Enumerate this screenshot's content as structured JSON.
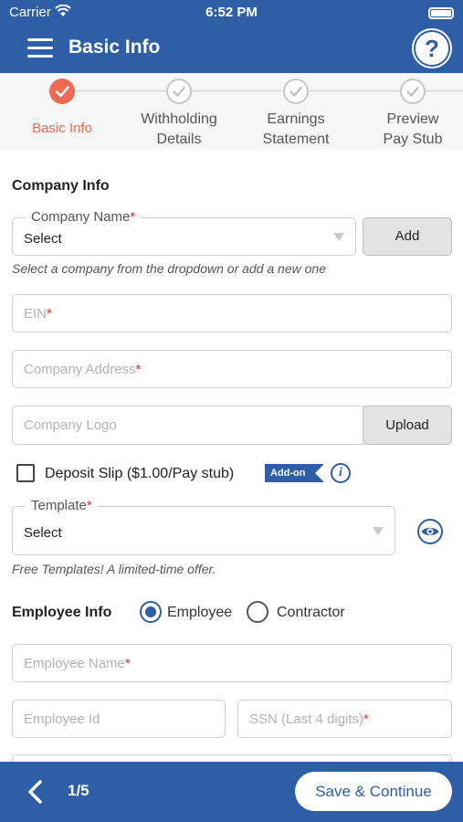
{
  "status_bar": {
    "carrier": "Carrier",
    "time": "6:52 PM"
  },
  "nav": {
    "title": "Basic Info",
    "help_label": "?"
  },
  "stepper": {
    "steps": [
      {
        "label": "Basic Info",
        "state": "done"
      },
      {
        "label": "Withholding\nDetails",
        "state": "todo"
      },
      {
        "label": "Earnings\nStatement",
        "state": "todo"
      },
      {
        "label": "Preview\nPay Stub",
        "state": "todo"
      }
    ]
  },
  "company_info": {
    "title": "Company Info",
    "company_name": {
      "label": "Company Name",
      "required_mark": "*",
      "value": "Select"
    },
    "add_label": "Add",
    "helper": "Select a company from the dropdown or add a new one",
    "ein": {
      "placeholder": "EIN",
      "required_mark": "*"
    },
    "address": {
      "placeholder": "Company Address",
      "required_mark": "*"
    },
    "logo": {
      "placeholder": "Company Logo"
    },
    "upload_label": "Upload",
    "deposit_slip": {
      "label": "Deposit Slip ($1.00/Pay stub)",
      "checked": false,
      "badge": "Add-on"
    },
    "template": {
      "label": "Template",
      "required_mark": "*",
      "value": "Select"
    },
    "template_helper": "Free Templates! A limited-time offer."
  },
  "employee_info": {
    "title": "Employee Info",
    "type_options": [
      {
        "label": "Employee",
        "selected": true
      },
      {
        "label": "Contractor",
        "selected": false
      }
    ],
    "employee_name": {
      "placeholder": "Employee Name",
      "required_mark": "*"
    },
    "employee_id": {
      "placeholder": "Employee Id"
    },
    "ssn": {
      "placeholder": "SSN (Last 4 digits)",
      "required_mark": "*"
    }
  },
  "footer": {
    "page_indicator": "1/5",
    "save_label": "Save & Continue"
  },
  "colors": {
    "primary": "#2e5ea5",
    "accent": "#ef6a54",
    "required": "#e03131"
  }
}
